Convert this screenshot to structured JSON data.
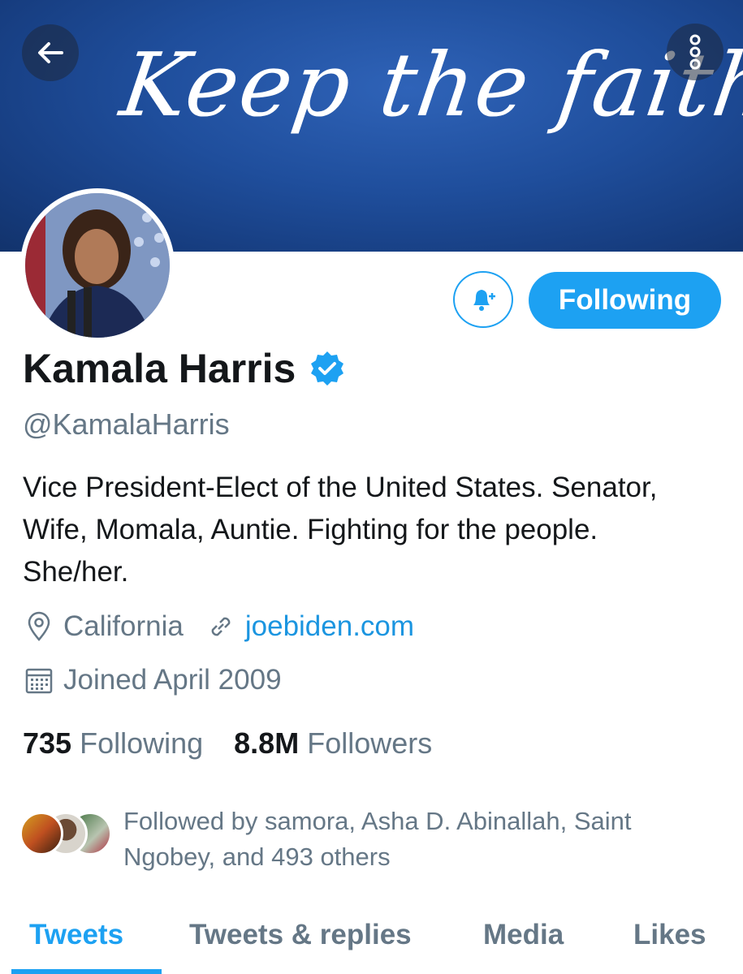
{
  "banner": {
    "script_text": "Keep the faith!",
    "back_icon": "arrow-left-icon",
    "more_icon": "more-vertical-icon"
  },
  "actions": {
    "notify_icon": "bell-plus-icon",
    "following_label": "Following"
  },
  "profile": {
    "name": "Kamala Harris",
    "verified_icon": "verified-badge-icon",
    "handle": "@KamalaHarris",
    "bio_lines": [
      "Vice President-Elect of the United States. Senator,",
      "Wife, Momala, Auntie. Fighting for the people.",
      "She/her."
    ],
    "location": "California",
    "website": "joebiden.com",
    "joined": "Joined April 2009"
  },
  "stats": {
    "following_count": "735",
    "following_label": "Following",
    "followers_count": "8.8M",
    "followers_label": "Followers"
  },
  "followed_by": {
    "lines": [
      "Followed by samora, Asha D. Abinallah, Saint",
      "Ngobey, and 493 others"
    ]
  },
  "tabs": [
    {
      "label": "Tweets",
      "active": true
    },
    {
      "label": "Tweets & replies",
      "active": false
    },
    {
      "label": "Media",
      "active": false
    },
    {
      "label": "Likes",
      "active": false
    }
  ],
  "colors": {
    "accent": "#1da1f2",
    "link": "#1b95e0",
    "secondary_text": "#657786",
    "banner_blue": "#1f4e9c"
  }
}
